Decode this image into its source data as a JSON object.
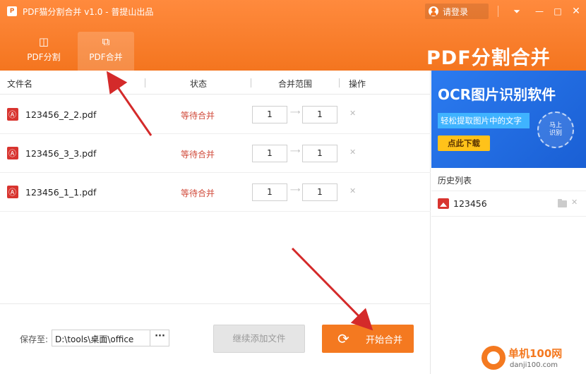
{
  "window": {
    "title": "PDF猫分割合并 v1.0 - 普提山出品",
    "login_label": "请登录",
    "menu_icon": "chevron-down-icon",
    "min_icon": "minimize-icon",
    "max_icon": "maximize-icon",
    "close_icon": "close-icon"
  },
  "modes": {
    "split_label": "PDF分割",
    "merge_label": "PDF合并",
    "active": "merge"
  },
  "brand": "PDF分割合并",
  "table": {
    "headers": {
      "filename": "文件名",
      "status": "状态",
      "range": "合并范围",
      "action": "操作"
    },
    "rows": [
      {
        "filename": "123456_2_2.pdf",
        "status": "等待合并",
        "from": "1",
        "to": "1"
      },
      {
        "filename": "123456_3_3.pdf",
        "status": "等待合并",
        "from": "1",
        "to": "1"
      },
      {
        "filename": "123456_1_1.pdf",
        "status": "等待合并",
        "from": "1",
        "to": "1"
      }
    ]
  },
  "footer": {
    "save_label": "保存至:",
    "save_path": "D:\\tools\\桌面\\office",
    "browse_label": "···",
    "add_label": "继续添加文件",
    "start_label": "开始合并"
  },
  "ad": {
    "title": "OCR图片识别软件",
    "subtitle": "轻松提取图片中的文字",
    "button": "点此下载",
    "badge_line1": "马上",
    "badge_line2": "识别"
  },
  "history": {
    "title": "历史列表",
    "items": [
      {
        "name": "123456"
      }
    ]
  },
  "watermark": {
    "name": "单机100网",
    "url": "danji100.com"
  },
  "colors": {
    "accent": "#f47920",
    "status": "#d14b3b",
    "ad_blue": "#1a5fd4",
    "arrow": "#d42a2a"
  }
}
